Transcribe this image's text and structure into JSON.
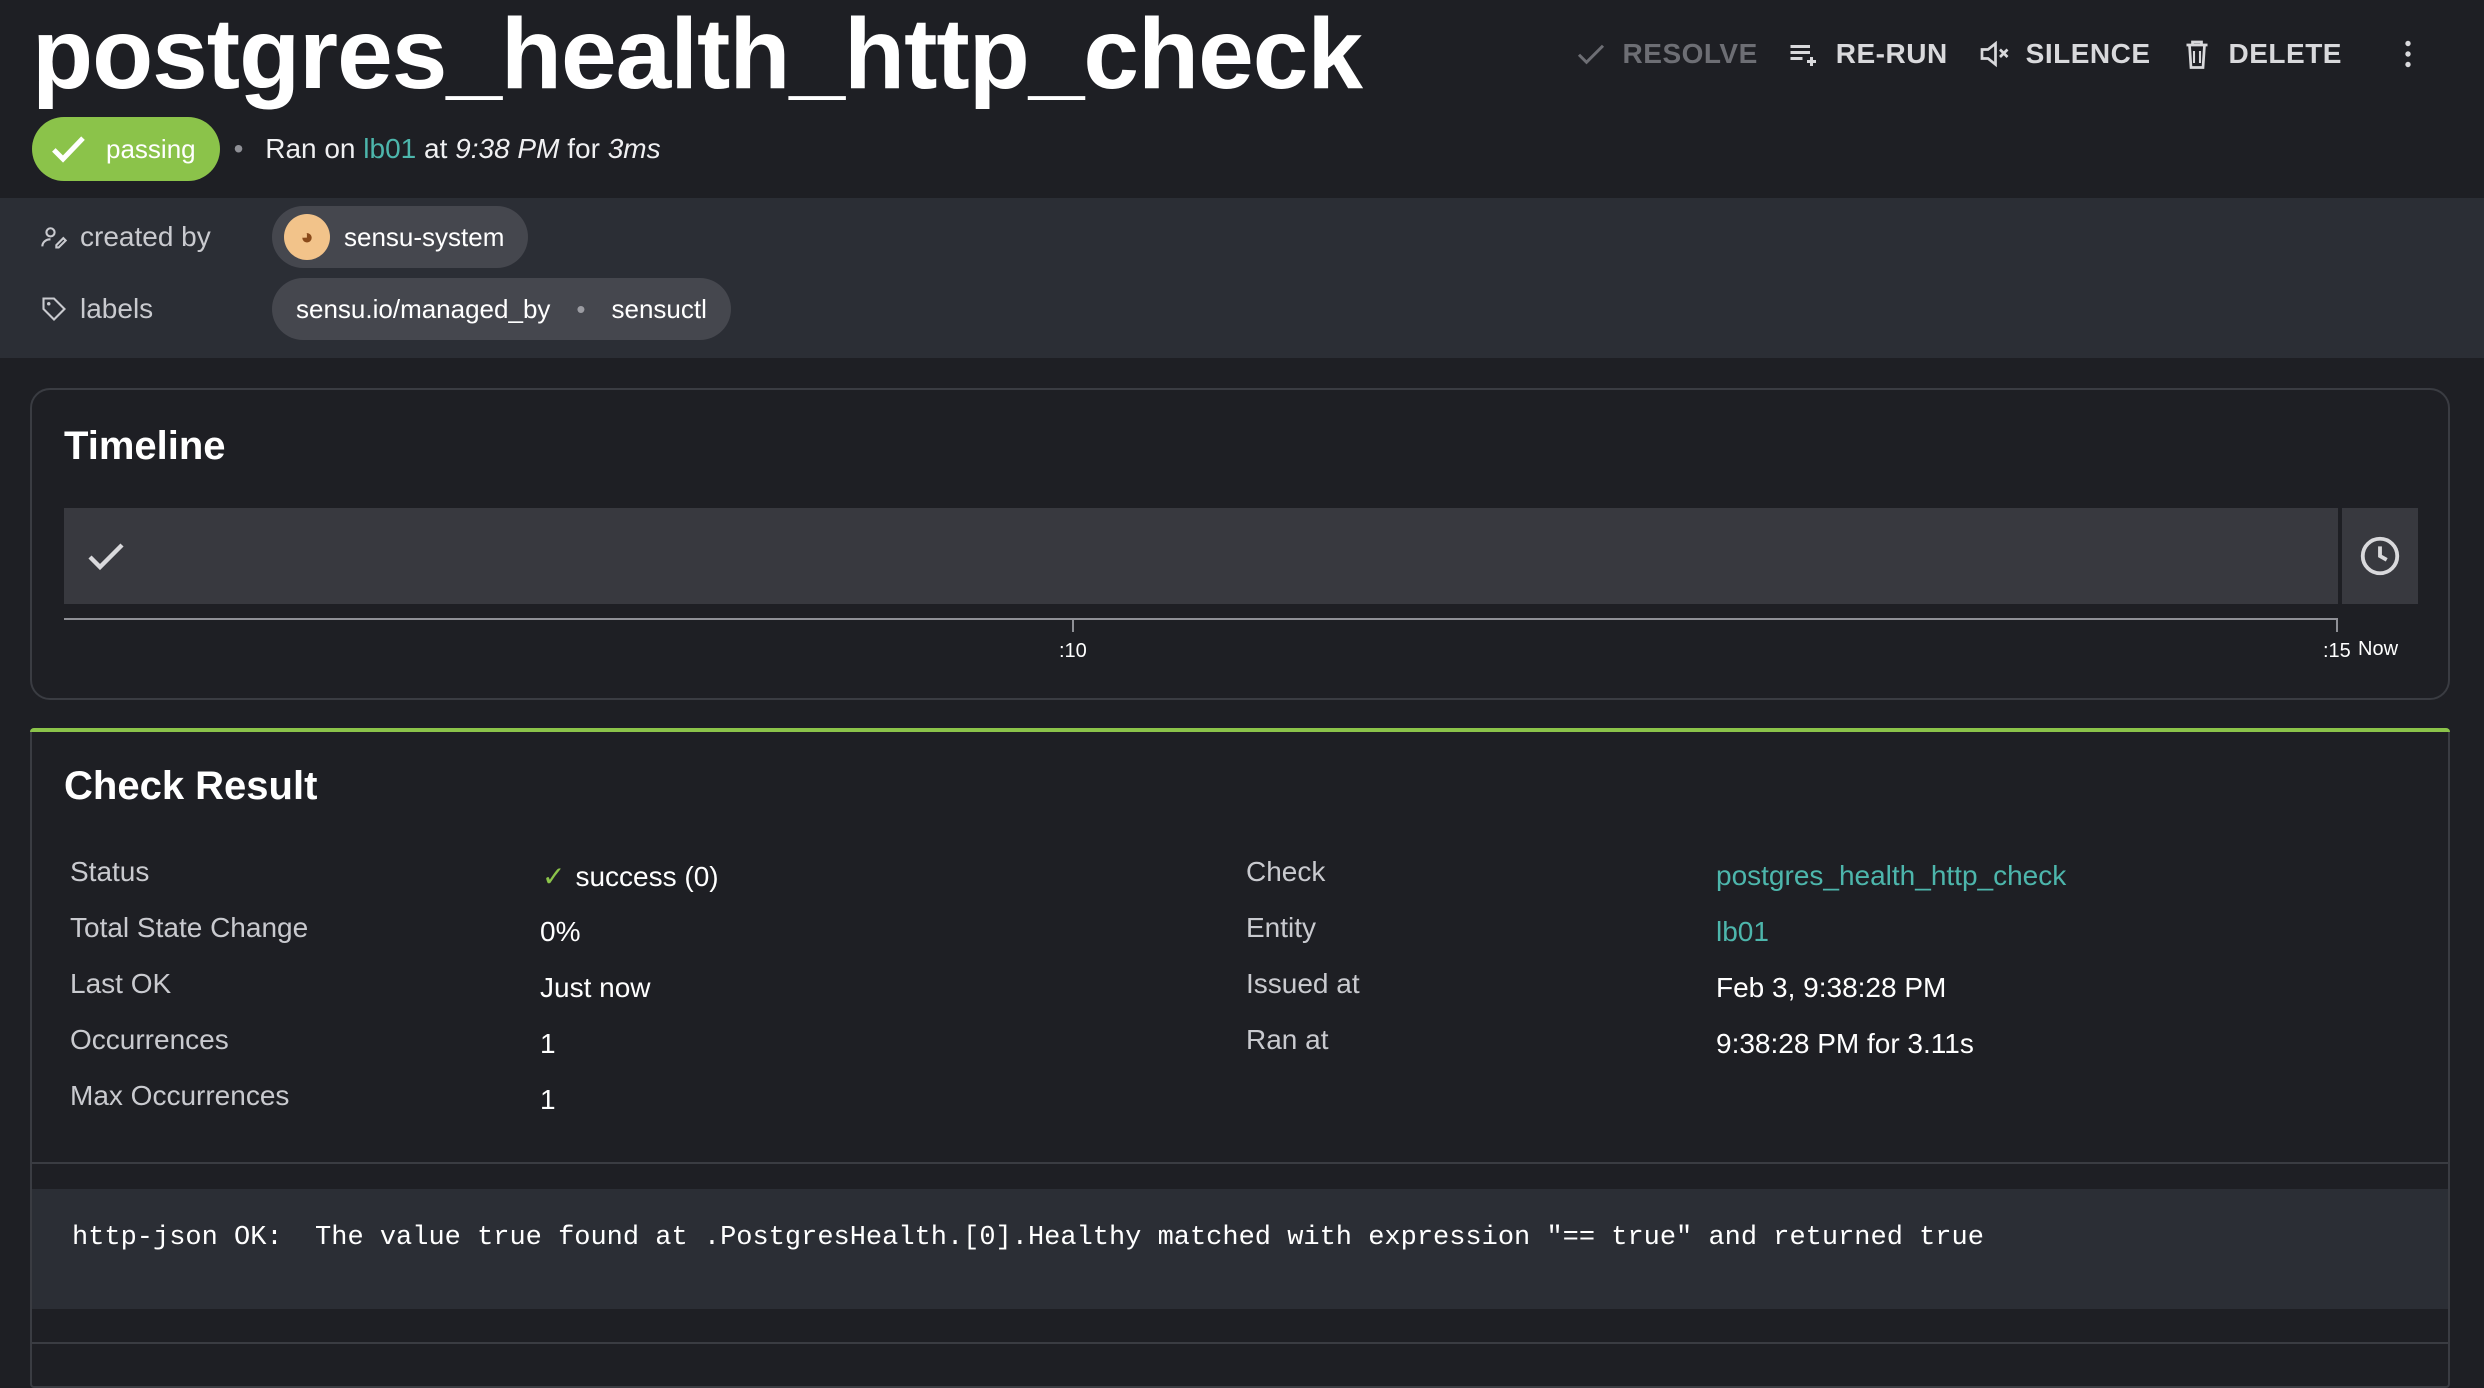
{
  "header": {
    "title": "postgres_health_http_check",
    "actions": {
      "resolve": "RESOLVE",
      "rerun": "RE-RUN",
      "silence": "SILENCE",
      "delete": "DELETE"
    },
    "status": {
      "label": "passing",
      "ran_prefix": "Ran on",
      "entity": "lb01",
      "at": "at",
      "time": "9:38 PM",
      "for": "for",
      "duration": "3ms"
    }
  },
  "meta": {
    "created_by_label": "created by",
    "created_by_value": "sensu-system",
    "labels_label": "labels",
    "label_key": "sensu.io/managed_by",
    "label_value": "sensuctl"
  },
  "timeline": {
    "title": "Timeline",
    "ticks": [
      ":10",
      ":15"
    ],
    "now": "Now"
  },
  "result": {
    "title": "Check Result",
    "left": [
      {
        "label": "Status",
        "value": "success (0)"
      },
      {
        "label": "Total State Change",
        "value": "0%"
      },
      {
        "label": "Last OK",
        "value": "Just now"
      },
      {
        "label": "Occurrences",
        "value": "1"
      },
      {
        "label": "Max Occurrences",
        "value": "1"
      }
    ],
    "right": [
      {
        "label": "Check",
        "value": "postgres_health_http_check"
      },
      {
        "label": "Entity",
        "value": "lb01"
      },
      {
        "label": "Issued at",
        "value": "Feb 3, 9:38:28 PM"
      },
      {
        "label": "Ran at",
        "value": "9:38:28 PM for 3.11s"
      }
    ],
    "output": "http-json OK:  The value true found at .PostgresHealth.[0].Healthy matched with expression \"== true\" and returned true"
  },
  "colors": {
    "passing": "#8bc34a",
    "link": "#4db6ac",
    "background": "#1e1f24",
    "panel": "#2b2e35"
  }
}
